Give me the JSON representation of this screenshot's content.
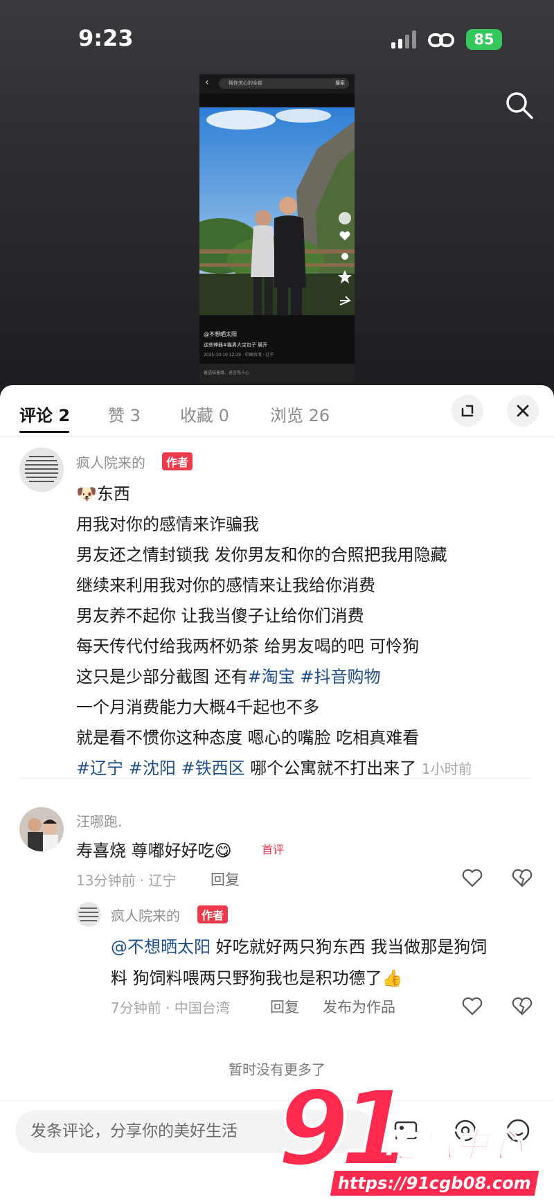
{
  "status_bar": {
    "time": "9:23",
    "battery": "85"
  },
  "embedded_post": {
    "search_placeholder": "搜你关心的全部",
    "search_button": "搜索",
    "author": "@不想晒太阳",
    "description": "这些神器#猫男大宝包子  展开",
    "date": "2025-10-10 12:29 · 中国台湾 · 辽宁",
    "input_placeholder": "善语结善缘，恶言伤人心"
  },
  "tabs": [
    {
      "label": "评论 2"
    },
    {
      "label": "赞 3"
    },
    {
      "label": "收藏 0"
    },
    {
      "label": "浏览 26"
    }
  ],
  "comments": [
    {
      "username": "疯人院来的",
      "tag": "作者",
      "lines": [
        "🐶东西",
        "用我对你的感情来诈骗我",
        "男友还之情封锁我 发你男友和你的合照把我用隐藏",
        "继续来利用我对你的感情来让我给你消费",
        "男友养不起你 让我当傻子让给你们消费",
        "每天传代付给我两杯奶茶 给男友喝的吧 可怜狗"
      ],
      "line7_text": "这只是少部分截图 还有",
      "line7_tags": [
        "#淘宝",
        "#抖音购物"
      ],
      "line8": "一个月消费能力大概4千起也不多",
      "line9": "就是看不惯你这种态度 嗯心的嘴脸 吃相真难看",
      "last_tags": [
        "#辽宁",
        "#沈阳",
        "#铁西区"
      ],
      "last_text": "哪个公寓就不打出来了",
      "time": "1小时前"
    },
    {
      "username": "汪哪跑.",
      "text": "寿喜烧 尊嘟好好吃😋",
      "badge": "首评",
      "meta": "13分钟前 · 辽宁",
      "reply": "回复"
    }
  ],
  "reply": {
    "username": "疯人院来的",
    "tag": "作者",
    "mention": "@不想晒太阳",
    "text1": " 好吃就好两只狗东西 我当做那是狗饲",
    "text2": "料 狗饲料喂两只野狗我也是积功德了👍",
    "meta": "7分钟前 · 中国台湾",
    "reply": "回复",
    "publish": "发布为作品"
  },
  "no_more": "暂时没有更多了",
  "comment_input_placeholder": "发条评论，分享你的美好生活",
  "watermark": {
    "big": "91",
    "name": "吃瓜中心",
    "url": "https://91cgb08.com"
  },
  "colors": {
    "hashtag": "#1e4e8a",
    "author_tag": "#ee3a4a",
    "battery": "#34c759",
    "watermark": "#ff2a4e"
  }
}
